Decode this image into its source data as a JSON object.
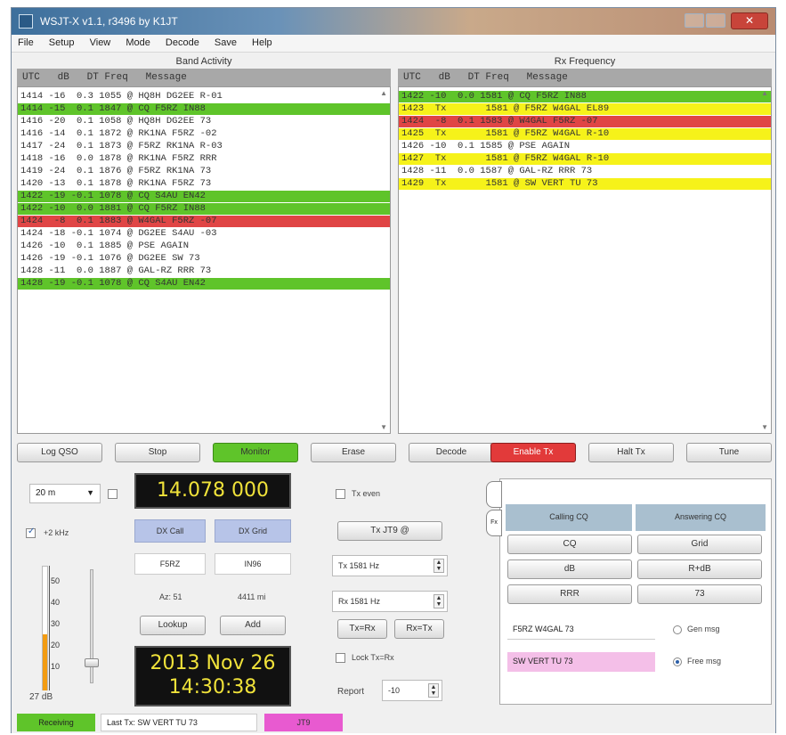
{
  "titlebar": {
    "title": "WSJT-X  v1.1, r3496   by K1JT",
    "close": "✕"
  },
  "menu": [
    "File",
    "Setup",
    "View",
    "Mode",
    "Decode",
    "Save",
    "Help"
  ],
  "band_activity": {
    "title": "Band Activity",
    "header": "UTC   dB   DT Freq   Message",
    "lines": [
      {
        "text": "1414 -16  0.3 1055 @ HQ8H DG2EE R-01",
        "color": "none"
      },
      {
        "text": "1414 -15  0.1 1847 @ CQ F5RZ IN88",
        "color": "green"
      },
      {
        "text": "1416 -20  0.1 1058 @ HQ8H DG2EE 73",
        "color": "none"
      },
      {
        "text": "1416 -14  0.1 1872 @ RK1NA F5RZ -02",
        "color": "none"
      },
      {
        "text": "1417 -24  0.1 1873 @ F5RZ RK1NA R-03",
        "color": "none"
      },
      {
        "text": "1418 -16  0.0 1878 @ RK1NA F5RZ RRR",
        "color": "none"
      },
      {
        "text": "1419 -24  0.1 1876 @ F5RZ RK1NA 73",
        "color": "none"
      },
      {
        "text": "1420 -13  0.1 1878 @ RK1NA F5RZ 73",
        "color": "none"
      },
      {
        "text": "1422 -19 -0.1 1078 @ CQ S4AU EN42",
        "color": "green"
      },
      {
        "text": "1422 -10  0.0 1881 @ CQ F5RZ IN88",
        "color": "green"
      },
      {
        "text": "1424  -8  0.1 1883 @ W4GAL F5RZ -07",
        "color": "red"
      },
      {
        "text": "1424 -18 -0.1 1074 @ DG2EE S4AU -03",
        "color": "none"
      },
      {
        "text": "1426 -10  0.1 1885 @ PSE AGAIN",
        "color": "none"
      },
      {
        "text": "1426 -19 -0.1 1076 @ DG2EE SW 73",
        "color": "none"
      },
      {
        "text": "1428 -11  0.0 1887 @ GAL-RZ RRR 73",
        "color": "none"
      },
      {
        "text": "1428 -19 -0.1 1078 @ CQ S4AU EN42",
        "color": "green"
      }
    ]
  },
  "rx_frequency": {
    "title": "Rx Frequency",
    "header": "UTC   dB   DT Freq   Message",
    "lines": [
      {
        "text": "1422 -10  0.0 1581 @ CQ F5RZ IN88",
        "color": "green"
      },
      {
        "text": "1423  Tx       1581 @ F5RZ W4GAL EL89",
        "color": "yellow"
      },
      {
        "text": "1424  -8  0.1 1583 @ W4GAL F5RZ -07",
        "color": "red"
      },
      {
        "text": "1425  Tx       1581 @ F5RZ W4GAL R-10",
        "color": "yellow"
      },
      {
        "text": "1426 -10  0.1 1585 @ PSE AGAIN",
        "color": "none"
      },
      {
        "text": "1427  Tx       1581 @ F5RZ W4GAL R-10",
        "color": "yellow"
      },
      {
        "text": "1428 -11  0.0 1587 @ GAL-RZ RRR 73",
        "color": "none"
      },
      {
        "text": "1429  Tx       1581 @ SW VERT TU 73",
        "color": "yellow"
      }
    ]
  },
  "buttons": {
    "log_qso": "Log QSO",
    "stop": "Stop",
    "monitor": "Monitor",
    "erase": "Erase",
    "decode": "Decode",
    "enable_tx": "Enable Tx",
    "halt_tx": "Halt Tx",
    "tune": "Tune"
  },
  "controls": {
    "band": "20 m",
    "freq_display": "14.078 000",
    "khz_label": "+2 kHz",
    "dx_call_label": "DX Call",
    "dx_grid_label": "DX Grid",
    "dx_call": "F5RZ",
    "dx_grid": "IN96",
    "az": "Az: 51",
    "dist": "4411 mi",
    "lookup": "Lookup",
    "add": "Add",
    "date": "2013 Nov 26",
    "time": "14:30:38",
    "db_readout": "27 dB",
    "meter_ticks": [
      "50",
      "40",
      "30",
      "20",
      "10"
    ],
    "meter_level_db": 27,
    "tx_even": "Tx even",
    "tx_jt9": "Tx JT9 @",
    "tx_freq": "Tx  1581 Hz",
    "rx_freq": "Rx  1581 Hz",
    "tx_eq_rx": "Tx=Rx",
    "rx_eq_tx": "Rx=Tx",
    "lock": "Lock Tx=Rx",
    "report_label": "Report",
    "report_value": "-10"
  },
  "msgs": {
    "tab1": "",
    "tab2": "Fx",
    "calling_cq": "Calling CQ",
    "answering_cq": "Answering CQ",
    "rows": [
      [
        "CQ",
        "Grid"
      ],
      [
        "dB",
        "R+dB"
      ],
      [
        "RRR",
        "73"
      ]
    ],
    "gen_msg_text": "F5RZ W4GAL 73",
    "gen_msg_label": "Gen msg",
    "free_msg_text": "SW VERT TU 73",
    "free_msg_label": "Free msg"
  },
  "status": {
    "state": "Receiving",
    "last_tx": "Last Tx: SW VERT TU 73",
    "mode": "JT9"
  },
  "colors": {
    "green": "#5fc42a",
    "red": "#e04545",
    "yellow": "#f6f21a",
    "meter": "#f39c12"
  }
}
